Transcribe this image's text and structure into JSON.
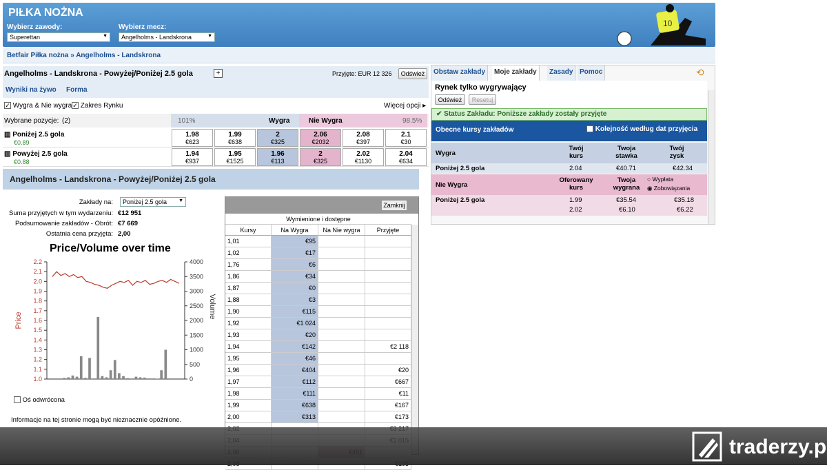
{
  "header": {
    "title": "PIŁKA NOŻNA",
    "competition_label": "Wybierz zawody:",
    "competition_value": "Superettan",
    "match_label": "Wybierz mecz:",
    "match_value": "Angelholms - Landskrona"
  },
  "breadcrumb": "Betfair Piłka nożna » Angelholms - Landskrona",
  "market": {
    "title": "Angelholms - Landskrona - Powyżej/Poniżej 2.5 gola",
    "plus": "+",
    "matched": "Przyjęte: EUR 12 326",
    "refresh": "Odśwież"
  },
  "links": {
    "live": "Wyniki na żywo",
    "form": "Forma"
  },
  "options": {
    "back_lay": "Wygra & Nie wygra",
    "range": "Zakres Rynku",
    "more": "Więcej opcji"
  },
  "positions": {
    "label": "Wybrane pozycje:",
    "count": "(2)",
    "back_pct": "101%",
    "back_label": "Wygra",
    "lay_label": "Nie Wygra",
    "lay_pct": "98.5%"
  },
  "runners": [
    {
      "name": "Poniżej 2.5 gola",
      "pl": "€0.89",
      "prices": [
        [
          "1.98",
          "€623"
        ],
        [
          "1.99",
          "€638"
        ],
        [
          "2",
          "€325"
        ],
        [
          "2.06",
          "€2032"
        ],
        [
          "2.08",
          "€397"
        ],
        [
          "2.1",
          "€30"
        ]
      ]
    },
    {
      "name": "Powyżej 2.5 gola",
      "pl": "€0.88",
      "prices": [
        [
          "1.94",
          "€937"
        ],
        [
          "1.95",
          "€1525"
        ],
        [
          "1.96",
          "€113"
        ],
        [
          "2",
          "€325"
        ],
        [
          "2.02",
          "€1130"
        ],
        [
          "2.04",
          "€634"
        ]
      ]
    }
  ],
  "section_title": "Angelholms - Landskrona - Powyżej/Poniżej 2.5 gola",
  "info": {
    "bets_on_label": "Zakłady na:",
    "bets_on_value": "Poniżej 2.5 gola",
    "total_label": "Suma przyjętych w tym wydarzeniu:",
    "total_value": "€12 951",
    "summary_label": "Podsumowanie zakładów - Obrót:",
    "summary_value": "€7 669",
    "last_label": "Ostatnia cena przyjęta:",
    "last_value": "2,00"
  },
  "chart_data": {
    "type": "line",
    "title": "Price/Volume over time",
    "ylabel": "Price",
    "y2label": "Volume",
    "ylim": [
      1.0,
      2.2
    ],
    "y2lim": [
      0,
      4000
    ],
    "yticks": [
      "2.2",
      "2.1",
      "2.0",
      "1.9",
      "1.8",
      "1.7",
      "1.6",
      "1.5",
      "1.4",
      "1.3",
      "1.2",
      "1.1",
      "1.0"
    ],
    "y2ticks": [
      "4000",
      "3500",
      "3000",
      "2500",
      "2000",
      "1500",
      "1000",
      "500",
      "0"
    ],
    "price": [
      2.05,
      2.1,
      2.06,
      2.08,
      2.05,
      2.07,
      2.04,
      2.05,
      2.0,
      1.99,
      1.97,
      1.96,
      1.94,
      1.93,
      1.96,
      1.98,
      2.0,
      1.99,
      2.01,
      1.96,
      2.0,
      1.99,
      2.01,
      1.97,
      1.98,
      2.0,
      2.01,
      1.99,
      2.02,
      2.0,
      1.98
    ],
    "volume": [
      0,
      0,
      20,
      40,
      60,
      120,
      80,
      780,
      40,
      720,
      0,
      2120,
      100,
      60,
      300,
      650,
      200,
      100,
      30,
      0,
      80,
      60,
      50,
      0,
      20,
      10,
      300,
      1000,
      0,
      0,
      0
    ]
  },
  "axis_checkbox": "Oś odwrócona",
  "disclaimer": "Informacje na tej stronie mogą być nieznacznie opóźnione.",
  "ladder": {
    "close": "Zamknij",
    "subtitle": "Wymienione i dostępne",
    "headers": [
      "Kursy",
      "Na Wygra",
      "Na Nie wygra",
      "Przyjęte"
    ],
    "rows": [
      [
        "1,01",
        "€95",
        "",
        ""
      ],
      [
        "1,02",
        "€17",
        "",
        ""
      ],
      [
        "1,76",
        "€6",
        "",
        ""
      ],
      [
        "1,86",
        "€34",
        "",
        ""
      ],
      [
        "1,87",
        "€0",
        "",
        ""
      ],
      [
        "1,88",
        "€3",
        "",
        ""
      ],
      [
        "1,90",
        "€115",
        "",
        ""
      ],
      [
        "1,92",
        "€1 024",
        "",
        ""
      ],
      [
        "1,93",
        "€20",
        "",
        ""
      ],
      [
        "1,94",
        "€142",
        "",
        "€2 118"
      ],
      [
        "1,95",
        "€46",
        "",
        ""
      ],
      [
        "1,96",
        "€404",
        "",
        "€20"
      ],
      [
        "1,97",
        "€112",
        "",
        "€667"
      ],
      [
        "1,98",
        "€111",
        "",
        "€11"
      ],
      [
        "1,99",
        "€638",
        "",
        "€167"
      ],
      [
        "2,00",
        "€313",
        "",
        "€173"
      ],
      [
        "2,02",
        "",
        "",
        "€3 217"
      ],
      [
        "2,04",
        "",
        "",
        "€1 015"
      ],
      [
        "2,06",
        "",
        "€481",
        ""
      ],
      [
        "2,08",
        "",
        "",
        "€193"
      ]
    ]
  },
  "rp": {
    "tabs": [
      "Obstaw zakłady",
      "Moje zakłady",
      "Zasady",
      "Pomoc"
    ],
    "heading": "Rynek tylko wygrywający",
    "refresh": "Odśwież",
    "reset": "Resetuj",
    "status": "Status Zakładu: Poniższe zakłady zostały przyjęte",
    "current": "Obecne kursy zakładów",
    "sort": "Kolejność według dat przyjęcia",
    "back_hdr": "Wygra",
    "col1": "Twój kurs",
    "col2": "Twoja stawka",
    "col3": "Twój zysk",
    "back_row": {
      "name": "Poniżej 2.5 gola",
      "odds": "2.04",
      "stake": "€40.71",
      "profit": "€42.34"
    },
    "lay_hdr": "Nie Wygra",
    "lcol1": "Oferowany kurs",
    "lcol2": "Twoja wygrana",
    "radio1": "Wypłata",
    "radio2": "Zobowiązania",
    "lay_rows": [
      {
        "name": "Poniżej 2.5 gola",
        "odds": "1.99",
        "stake": "€35.54",
        "liab": "€35.18"
      },
      {
        "name": "",
        "odds": "2.02",
        "stake": "€6.10",
        "liab": "€6.22"
      }
    ]
  },
  "footer_brand": "traderzy.pl",
  "colors": {
    "header": "#4a8bcb",
    "back": "#b7c6dc",
    "lay": "#e4b4cc",
    "price_line": "#c0392b",
    "volume_bar": "#888888"
  }
}
